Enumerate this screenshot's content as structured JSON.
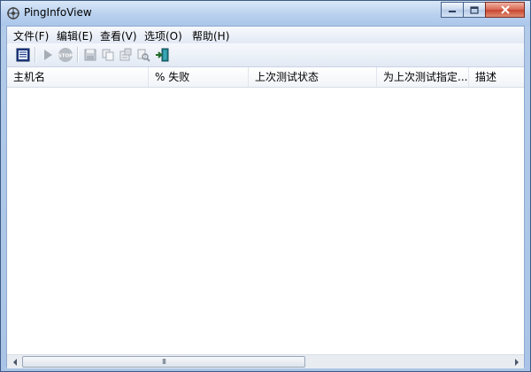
{
  "window": {
    "title": "PingInfoView"
  },
  "menu": [
    {
      "label": "文件(F)"
    },
    {
      "label": "编辑(E)"
    },
    {
      "label": "查看(V)"
    },
    {
      "label": "选项(O)"
    },
    {
      "label": "帮助(H)"
    }
  ],
  "toolbar": {
    "buttons": [
      {
        "icon": "list-icon"
      },
      {
        "icon": "play-icon"
      },
      {
        "icon": "stop-icon",
        "label": "STOP"
      },
      {
        "icon": "save-icon"
      },
      {
        "icon": "copy-icon"
      },
      {
        "icon": "properties-icon"
      },
      {
        "icon": "find-icon"
      },
      {
        "icon": "exit-icon"
      }
    ]
  },
  "table": {
    "columns": [
      "主机名",
      "% 失败",
      "上次测试状态",
      "为上次测试指定...",
      "描述"
    ],
    "rows": []
  },
  "scrollbar": {
    "grip": "III"
  }
}
